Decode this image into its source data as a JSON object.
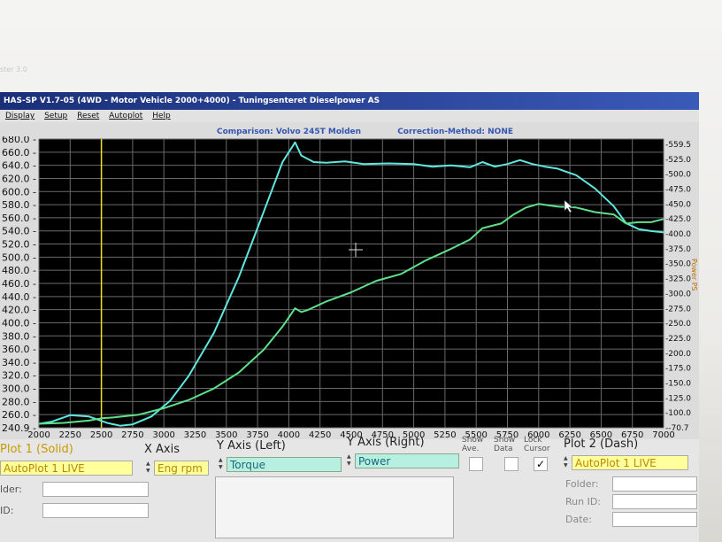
{
  "window": {
    "title": "HAS-SP V1.7-05  (4WD - Motor Vehicle 2000+4000) - Tuningsenteret Dieselpower AS",
    "faded_caption": "ster 3.0",
    "menu": [
      "Display",
      "Setup",
      "Reset",
      "Autoplot",
      "Help"
    ]
  },
  "header": {
    "comparison": "Comparison: Volvo 245T Molden",
    "correction": "Correction-Method: NONE"
  },
  "chart_data": {
    "type": "line",
    "background": "#000000",
    "grid": true,
    "x": {
      "label": "",
      "range": [
        2000,
        7000
      ],
      "ticks": [
        "2000",
        "2250",
        "2500",
        "2750",
        "3000",
        "3250",
        "3500",
        "3750",
        "4000",
        "4250",
        "4500",
        "4750",
        "5000",
        "5250",
        "5500",
        "5750",
        "6000",
        "6250",
        "6500",
        "6750",
        "7000"
      ]
    },
    "y_left": {
      "label": "",
      "range": [
        240.9,
        680.0
      ],
      "ticks": [
        "680.0",
        "660.0",
        "640.0",
        "620.0",
        "600.0",
        "580.0",
        "560.0",
        "540.0",
        "520.0",
        "500.0",
        "480.0",
        "460.0",
        "440.0",
        "420.0",
        "400.0",
        "380.0",
        "360.0",
        "340.0",
        "320.0",
        "300.0",
        "280.0",
        "260.0",
        "240.9"
      ]
    },
    "y_right": {
      "label": "Power PS",
      "range": [
        -70.7,
        559.5
      ],
      "ticks": [
        "559.5",
        "525.0",
        "500.0",
        "475.0",
        "450.0",
        "425.0",
        "400.0",
        "375.0",
        "350.0",
        "325.0",
        "300.0",
        "275.0",
        "250.0",
        "225.0",
        "200.0",
        "175.0",
        "150.0",
        "125.0",
        "100.0",
        "-70.7"
      ]
    },
    "cursor_x": 2500,
    "series": [
      {
        "color": "#5ee8e0",
        "axis": "left",
        "x": [
          2000,
          2100,
          2250,
          2400,
          2550,
          2650,
          2750,
          2900,
          3050,
          3200,
          3400,
          3600,
          3800,
          3950,
          4050,
          4100,
          4200,
          4300,
          4450,
          4600,
          4800,
          5000,
          5150,
          5300,
          5450,
          5550,
          5650,
          5750,
          5850,
          5950,
          6050,
          6150,
          6300,
          6450,
          6600,
          6700,
          6800,
          6900,
          7000
        ],
        "values": [
          247,
          250,
          260,
          258,
          248,
          244,
          246,
          258,
          282,
          320,
          385,
          470,
          570,
          645,
          675,
          655,
          645,
          644,
          646,
          642,
          643,
          642,
          638,
          640,
          637,
          645,
          638,
          642,
          648,
          642,
          638,
          635,
          625,
          605,
          578,
          552,
          543,
          540,
          538
        ]
      },
      {
        "color": "#5fe08a",
        "axis": "right",
        "x": [
          2000,
          2200,
          2400,
          2500,
          2600,
          2800,
          3000,
          3200,
          3400,
          3600,
          3800,
          3950,
          4050,
          4100,
          4150,
          4300,
          4500,
          4700,
          4900,
          5100,
          5300,
          5450,
          5550,
          5700,
          5800,
          5900,
          6000,
          6150,
          6300,
          6450,
          6600,
          6700,
          6800,
          6900,
          7000
        ],
        "values": [
          -62,
          -60,
          -55,
          -50,
          -48,
          -42,
          -28,
          -10,
          15,
          50,
          100,
          150,
          190,
          182,
          186,
          205,
          225,
          250,
          265,
          295,
          320,
          340,
          365,
          375,
          395,
          410,
          418,
          412,
          410,
          400,
          395,
          375,
          378,
          378,
          385
        ]
      }
    ]
  },
  "panel": {
    "plot1_label": "Plot 1 (Solid)",
    "plot1_value": "AutoPlot 1 LIVE",
    "x_axis_label": "X Axis",
    "x_axis_value": "Eng rpm",
    "y_left_label": "Y Axis (Left)",
    "y_left_value": "Torque",
    "y_right_label": "Y Axis (Right)",
    "y_right_value": "Power",
    "show_ave": [
      "Show",
      "Ave."
    ],
    "show_data": [
      "Show",
      "Data"
    ],
    "lock_cursor": [
      "Lock",
      "Cursor"
    ],
    "plot2_label": "Plot 2 (Dash)",
    "plot2_value": "AutoPlot 1 LIVE",
    "folder_label": "Folder:",
    "runid_label": "Run ID:",
    "date_label": "Date:",
    "left_folder_label": "lder:",
    "left_id_label": "ID:"
  }
}
